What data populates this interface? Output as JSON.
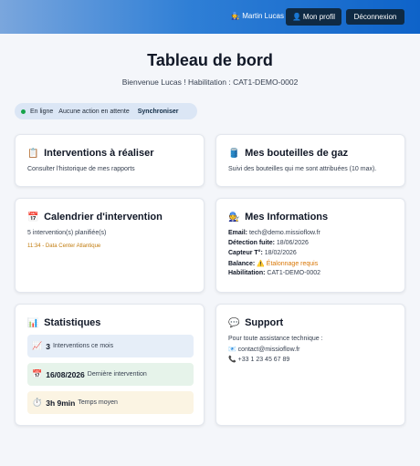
{
  "header": {
    "user_icon": "🧑‍🔧",
    "user_name": "Martin Lucas",
    "profile_icon": "👤",
    "profile_label": "Mon profil",
    "logout_label": "Déconnexion"
  },
  "page": {
    "title": "Tableau de bord",
    "welcome": "Bienvenue Lucas ! Habilitation : CAT1-DEMO-0002"
  },
  "status": {
    "online": "En ligne",
    "pending": "Aucune action en attente",
    "sync": "Synchroniser"
  },
  "cards": {
    "interventions": {
      "icon": "📋",
      "title": "Interventions à réaliser",
      "subtitle": "Consulter l'historique de mes rapports"
    },
    "bottles": {
      "icon": "🛢️",
      "title": "Mes bouteilles de gaz",
      "subtitle": "Suivi des bouteilles qui me sont attribuées (10 max)."
    },
    "calendar": {
      "icon": "📅",
      "title": "Calendrier d'intervention",
      "subtitle": "5 intervention(s) planifiée(s)",
      "event": "11:34 - Data Center Atlantique"
    },
    "info": {
      "icon": "🧑‍🔧",
      "title": "Mes Informations",
      "rows": [
        {
          "label": "Email:",
          "value": "tech@demo.missioflow.fr"
        },
        {
          "label": "Détection fuite:",
          "value": "18/06/2026"
        },
        {
          "label": "Capteur T°:",
          "value": "18/02/2026"
        },
        {
          "label": "Balance:",
          "value": "⚠️ Étalonnage requis"
        },
        {
          "label": "Habilitation:",
          "value": "CAT1-DEMO-0002"
        }
      ]
    },
    "stats": {
      "icon": "📊",
      "title": "Statistiques",
      "items": [
        {
          "icon": "📈",
          "value": "3",
          "label": "Interventions ce mois"
        },
        {
          "icon": "📅",
          "value": "16/08/2026",
          "label": "Dernière intervention"
        },
        {
          "icon": "⏱️",
          "value": "3h 9min",
          "label": "Temps moyen"
        }
      ]
    },
    "support": {
      "icon": "💬",
      "title": "Support",
      "intro": "Pour toute assistance technique :",
      "email_icon": "📧",
      "email": "contact@missioflow.fr",
      "phone_icon": "📞",
      "phone": "+33 1 23 45 67 89"
    }
  }
}
